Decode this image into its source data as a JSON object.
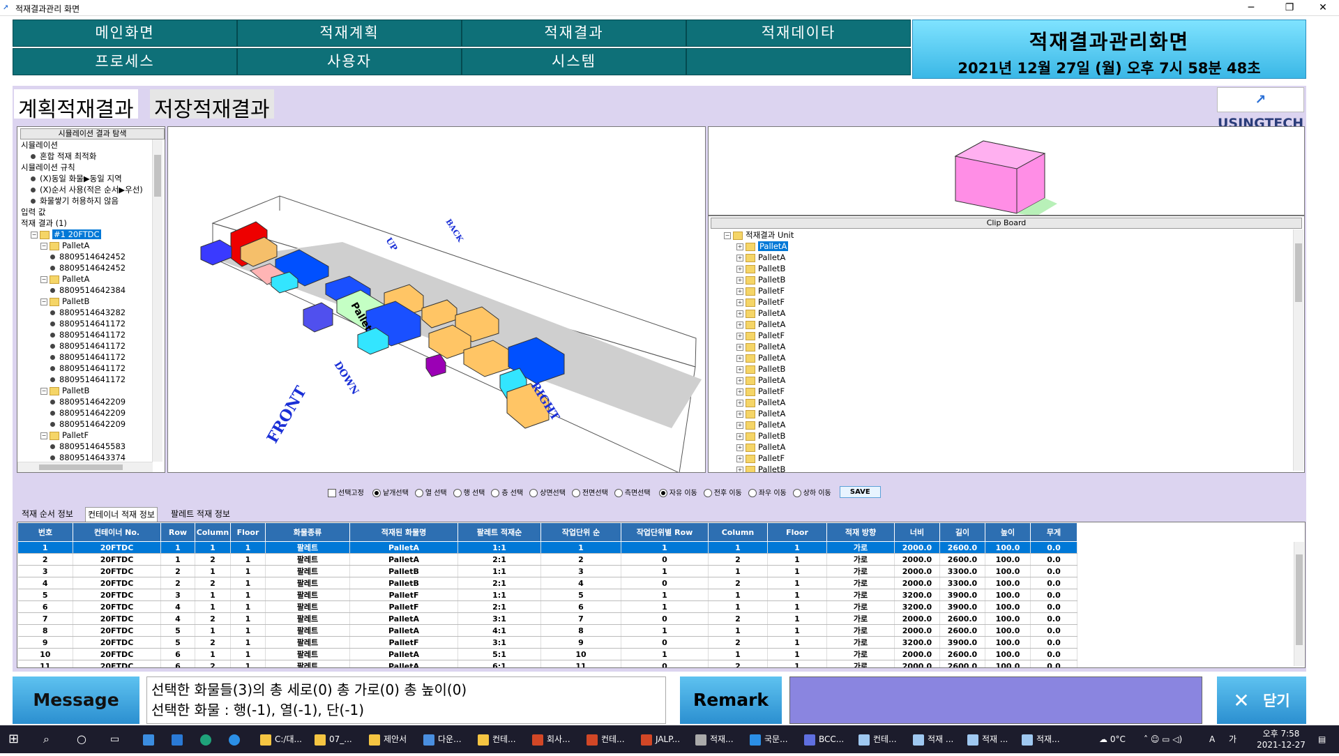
{
  "window": {
    "title": "적재결과관리 화면",
    "app_icon": "usingtech-icon"
  },
  "nav": {
    "row1": [
      "메인화면",
      "적재계획",
      "적재결과",
      "적재데이타"
    ],
    "row2": [
      "프로세스",
      "사용자",
      "시스템"
    ]
  },
  "header": {
    "title": "적재결과관리화면",
    "datetime": "2021년 12월 27일 (월) 오후 7시 58분 48초"
  },
  "tabs": {
    "plan": "계획적재결과",
    "stored": "저장적재결과"
  },
  "logo": "USINGTECH",
  "tree": {
    "header": "시뮬레이션 결과 탐색",
    "rows": [
      {
        "t": "시뮬레이션",
        "k": "folder",
        "d": 0
      },
      {
        "t": "혼합 적재 최적화",
        "k": "dot",
        "d": 1
      },
      {
        "t": "시뮬레이션 규칙",
        "k": "folder",
        "d": 0
      },
      {
        "t": "(X)동일 화물▶동일 지역",
        "k": "dot",
        "d": 1
      },
      {
        "t": "(X)순서 사용(적은 순서▶우선)",
        "k": "dot",
        "d": 1
      },
      {
        "t": "화물쌓기 허용하지 않음",
        "k": "dot",
        "d": 1
      },
      {
        "t": "입력 값",
        "k": "folder",
        "d": 0
      },
      {
        "t": "적재 결과 (1)",
        "k": "folder",
        "d": 0
      },
      {
        "t": "#1 20FTDC",
        "k": "selfolder",
        "d": 1
      },
      {
        "t": "PalletA",
        "k": "folder",
        "d": 2
      },
      {
        "t": "8809514642452",
        "k": "dot",
        "d": 3
      },
      {
        "t": "8809514642452",
        "k": "dot",
        "d": 3
      },
      {
        "t": "PalletA",
        "k": "folder",
        "d": 2
      },
      {
        "t": "8809514642384",
        "k": "dot",
        "d": 3
      },
      {
        "t": "PalletB",
        "k": "folder",
        "d": 2
      },
      {
        "t": "8809514643282",
        "k": "dot",
        "d": 3
      },
      {
        "t": "8809514641172",
        "k": "dot",
        "d": 3
      },
      {
        "t": "8809514641172",
        "k": "dot",
        "d": 3
      },
      {
        "t": "8809514641172",
        "k": "dot",
        "d": 3
      },
      {
        "t": "8809514641172",
        "k": "dot",
        "d": 3
      },
      {
        "t": "8809514641172",
        "k": "dot",
        "d": 3
      },
      {
        "t": "8809514641172",
        "k": "dot",
        "d": 3
      },
      {
        "t": "PalletB",
        "k": "folder",
        "d": 2
      },
      {
        "t": "8809514642209",
        "k": "dot",
        "d": 3
      },
      {
        "t": "8809514642209",
        "k": "dot",
        "d": 3
      },
      {
        "t": "8809514642209",
        "k": "dot",
        "d": 3
      },
      {
        "t": "PalletF",
        "k": "folder",
        "d": 2
      },
      {
        "t": "8809514645583",
        "k": "dot",
        "d": 3
      },
      {
        "t": "8809514643374",
        "k": "dot",
        "d": 3
      }
    ]
  },
  "view3d": {
    "labels": {
      "front": "FRONT",
      "down": "DOWN",
      "up": "UP",
      "back": "BACK",
      "right": "RIGHT",
      "pallet": "Pallet"
    }
  },
  "clipboard": {
    "header": "Clip Board",
    "root": "적재결과 Unit",
    "items": [
      "PalletA",
      "PalletA",
      "PalletB",
      "PalletB",
      "PalletF",
      "PalletF",
      "PalletA",
      "PalletA",
      "PalletF",
      "PalletA",
      "PalletA",
      "PalletB",
      "PalletA",
      "PalletF",
      "PalletA",
      "PalletA",
      "PalletA",
      "PalletB",
      "PalletA",
      "PalletF",
      "PalletB"
    ]
  },
  "toolbar": {
    "fix_label": "선택고정",
    "select_options": [
      "낱개선택",
      "열 선택",
      "행 선택",
      "층 선택",
      "상면선택",
      "전면선택",
      "측면선택"
    ],
    "move_options": [
      "자유 이동",
      "전후 이동",
      "좌우 이동",
      "상하 이동"
    ],
    "save": "SAVE"
  },
  "subtabs": [
    "적재 순서 정보",
    "컨테이너 적재 정보",
    "팔레트 적재 정보"
  ],
  "table": {
    "columns": [
      "번호",
      "컨테이너 No.",
      "Row",
      "Column",
      "Floor",
      "화물종류",
      "적재된 화물명",
      "팔레트 적재순",
      "작업단위 순",
      "작업단위별 Row",
      "Column",
      "Floor",
      "적재 방향",
      "너비",
      "길이",
      "높이",
      "무게"
    ],
    "rows": [
      [
        "1",
        "20FTDC",
        "1",
        "1",
        "1",
        "팔레트",
        "PalletA",
        "1:1",
        "1",
        "1",
        "1",
        "1",
        "가로",
        "2000.0",
        "2600.0",
        "100.0",
        "0.0"
      ],
      [
        "2",
        "20FTDC",
        "1",
        "2",
        "1",
        "팔레트",
        "PalletA",
        "2:1",
        "2",
        "0",
        "2",
        "1",
        "가로",
        "2000.0",
        "2600.0",
        "100.0",
        "0.0"
      ],
      [
        "3",
        "20FTDC",
        "2",
        "1",
        "1",
        "팔레트",
        "PalletB",
        "1:1",
        "3",
        "1",
        "1",
        "1",
        "가로",
        "2000.0",
        "3300.0",
        "100.0",
        "0.0"
      ],
      [
        "4",
        "20FTDC",
        "2",
        "2",
        "1",
        "팔레트",
        "PalletB",
        "2:1",
        "4",
        "0",
        "2",
        "1",
        "가로",
        "2000.0",
        "3300.0",
        "100.0",
        "0.0"
      ],
      [
        "5",
        "20FTDC",
        "3",
        "1",
        "1",
        "팔레트",
        "PalletF",
        "1:1",
        "5",
        "1",
        "1",
        "1",
        "가로",
        "3200.0",
        "3900.0",
        "100.0",
        "0.0"
      ],
      [
        "6",
        "20FTDC",
        "4",
        "1",
        "1",
        "팔레트",
        "PalletF",
        "2:1",
        "6",
        "1",
        "1",
        "1",
        "가로",
        "3200.0",
        "3900.0",
        "100.0",
        "0.0"
      ],
      [
        "7",
        "20FTDC",
        "4",
        "2",
        "1",
        "팔레트",
        "PalletA",
        "3:1",
        "7",
        "0",
        "2",
        "1",
        "가로",
        "2000.0",
        "2600.0",
        "100.0",
        "0.0"
      ],
      [
        "8",
        "20FTDC",
        "5",
        "1",
        "1",
        "팔레트",
        "PalletA",
        "4:1",
        "8",
        "1",
        "1",
        "1",
        "가로",
        "2000.0",
        "2600.0",
        "100.0",
        "0.0"
      ],
      [
        "9",
        "20FTDC",
        "5",
        "2",
        "1",
        "팔레트",
        "PalletF",
        "3:1",
        "9",
        "0",
        "2",
        "1",
        "가로",
        "3200.0",
        "3900.0",
        "100.0",
        "0.0"
      ],
      [
        "10",
        "20FTDC",
        "6",
        "1",
        "1",
        "팔레트",
        "PalletA",
        "5:1",
        "10",
        "1",
        "1",
        "1",
        "가로",
        "2000.0",
        "2600.0",
        "100.0",
        "0.0"
      ],
      [
        "11",
        "20FTDC",
        "6",
        "2",
        "1",
        "팔레트",
        "PalletA",
        "6:1",
        "11",
        "0",
        "2",
        "1",
        "가로",
        "2000.0",
        "2600.0",
        "100.0",
        "0.0"
      ]
    ]
  },
  "footer": {
    "message_btn": "Message",
    "message_line1": "선택한 화물들(3)의 총 세로(0) 총 가로(0) 총 높이(0)",
    "message_line2": "선택한 화물 : 행(-1), 열(-1), 단(-1)",
    "remark_btn": "Remark",
    "close_btn": "닫기",
    "close_icon": "close-x-icon"
  },
  "taskbar": {
    "items": [
      "C:/대...",
      "07_...",
      "제안서",
      "다운...",
      "컨테...",
      "회사...",
      "컨테...",
      "JALP...",
      "적재...",
      "국문...",
      "BCC...",
      "컨테...",
      "적재 ...",
      "적재 ...",
      "적재..."
    ],
    "temp": "0°C",
    "ime": "가",
    "time": "오후 7:58",
    "date": "2021-12-27"
  }
}
